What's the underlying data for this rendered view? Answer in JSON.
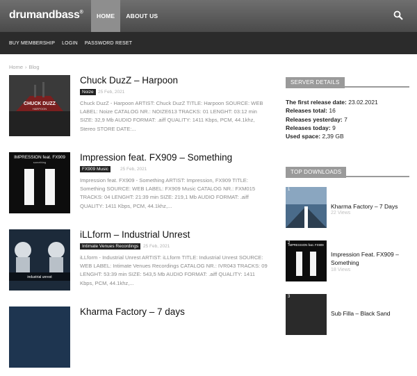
{
  "header": {
    "logo": "drumandbass",
    "logo_mark": "®",
    "nav": [
      "HOME",
      "ABOUT US"
    ]
  },
  "submenu": [
    "BUY MEMBERSHIP",
    "LOGIN",
    "PASSWORD RESET"
  ],
  "breadcrumb": [
    "Home",
    "Blog"
  ],
  "posts": [
    {
      "title": "Chuck DuzZ – Harpoon",
      "category": "Noize",
      "date": "25 Feb, 2021",
      "excerpt": "Chuck DuzZ - Harpoon ARTIST: Chuck DuzZ TITLE: Harpoon SOURCE: WEB LABEL: Noize CATALOG NR.: NOIZE613 TRACKS: 01 LENGHT: 03:12 min SIZE: 32,9 Mb AUDIO FORMAT: .aiff QUALITY: 1411 Kbps, PCM, 44.1khz, Stereo STORE DATE:...",
      "thumb_line1": "CHUCK DUZZ",
      "thumb_line2": "HARPOON"
    },
    {
      "title": "Impression feat. FX909 – Something",
      "category": "FX909 Music",
      "date": "25 Feb, 2021",
      "excerpt": "Impression feat. FX909 - Something ARTIST: Impression, FX909 TITLE: Something SOURCE: WEB LABEL: FX909 Music CATALOG NR.: FXM015 TRACKS: 04 LENGHT: 21:39 min SIZE: 219,1 Mb AUDIO FORMAT: .aiff QUALITY: 1411 Kbps, PCM, 44.1khz,...",
      "thumb_line1": "IMPRESSION feat. FX909",
      "thumb_line2": "something"
    },
    {
      "title": "iLLform – Industrial Unrest",
      "category": "Intimate Venues Recordings",
      "date": "25 Feb, 2021",
      "excerpt": "iLLform - Industrial Unrest ARTIST: iLLform TITLE: Industrial Unrest SOURCE: WEB LABEL: Intimate Venues Recordings CATALOG NR.: IVR043 TRACKS: 09 LENGHT: 53:39 min SIZE: 543,5 Mb AUDIO FORMAT: .aiff QUALITY: 1411 Kbps, PCM, 44.1khz,...",
      "thumb_line1": "industrial unrest",
      "thumb_line2": ""
    },
    {
      "title": "Kharma Factory – 7 days"
    }
  ],
  "sidebar": {
    "server_title": "SERVER DETAILS",
    "details": [
      {
        "label": "The first release date:",
        "value": "23.02.2021"
      },
      {
        "label": "Releases total:",
        "value": "16"
      },
      {
        "label": "Releases yesterday:",
        "value": "7"
      },
      {
        "label": "Releases today:",
        "value": "9"
      },
      {
        "label": "Used space:",
        "value": "2,39 GB"
      }
    ],
    "downloads_title": "TOP DOWNLOADS",
    "top": [
      {
        "rank": "1",
        "title": "Kharma Factory – 7 Days",
        "views": "22 Views"
      },
      {
        "rank": "2",
        "title": "Impression Feat. FX909 – Something",
        "views": "18 Views",
        "thumb_text": "IMPRESSION feat. FX909"
      },
      {
        "rank": "3",
        "title": "Sub Filla – Black Sand",
        "views": ""
      }
    ]
  },
  "colors": {
    "header": "#5a5a5a",
    "nav_active": "#8e8e8e",
    "submenu": "#2b2b2b",
    "block_title": "#9a9a9a"
  }
}
